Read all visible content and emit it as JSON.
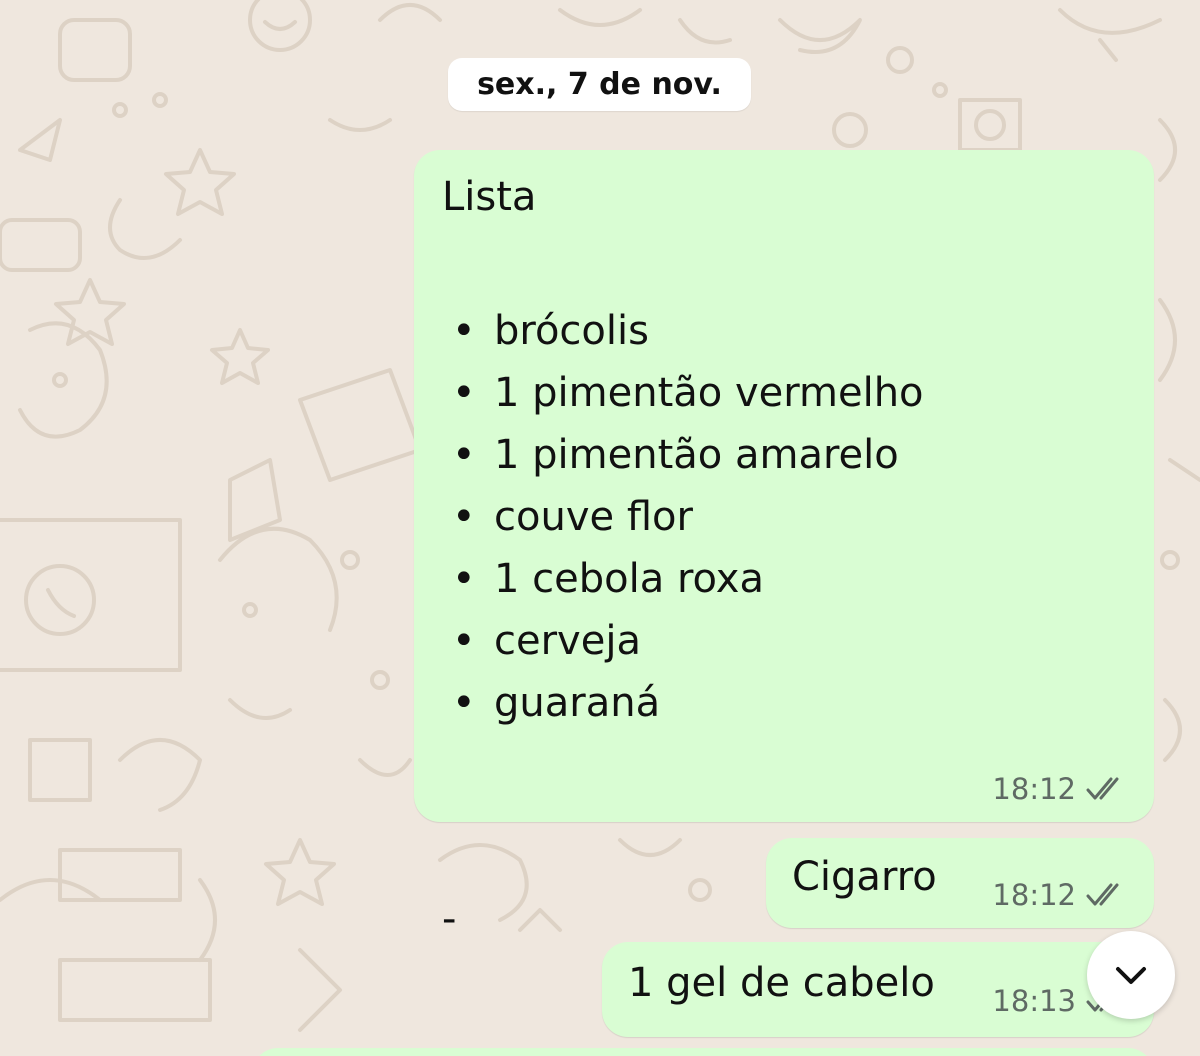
{
  "date_separator": "sex., 7 de nov.",
  "colors": {
    "chat_background": "#efe7de",
    "outgoing_bubble": "#d9fdd3",
    "timestamp": "#5f6a64"
  },
  "messages": [
    {
      "title": "Lista",
      "items": [
        "brócolis",
        "1 pimentão vermelho",
        "1 pimentão amarelo",
        "couve flor",
        "1 cebola roxa",
        "cerveja",
        "guaraná"
      ],
      "trailing": "-",
      "time": "18:12",
      "status_icon": "double-check-icon"
    },
    {
      "text": "Cigarro",
      "time": "18:12",
      "status_icon": "double-check-icon"
    },
    {
      "text": "1 gel de cabelo",
      "time": "18:13",
      "status_icon": "double-check-icon"
    }
  ],
  "scroll_button": {
    "icon": "chevron-down-icon"
  }
}
